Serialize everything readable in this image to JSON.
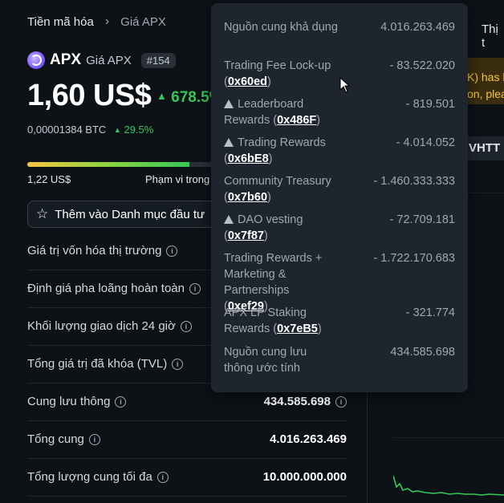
{
  "breadcrumb": {
    "root": "Tiền mã hóa",
    "current": "Giá APX"
  },
  "coin": {
    "symbol": "APX",
    "name": "Giá APX",
    "rank": "#154"
  },
  "price": {
    "value": "1,60 US$",
    "change": "678.5%",
    "btc": "0,00001384 BTC",
    "btc_change": "29.5%"
  },
  "range": {
    "low": "1,22 US$",
    "label": "Phạm vi trong",
    "position_pct": 84
  },
  "watchlist": {
    "label": "Thêm vào Danh mục đầu tư"
  },
  "stats": [
    {
      "label": "Giá trị vốn hóa thị trường",
      "value": ""
    },
    {
      "label": "Định giá pha loãng hoàn toàn",
      "value": ""
    },
    {
      "label": "Khối lượng giao dịch 24 giờ",
      "value": ""
    },
    {
      "label": "Tổng giá trị đã khóa (TVL)",
      "value": ""
    },
    {
      "label": "Cung lưu thông",
      "value": "434.585.698"
    },
    {
      "label": "Tổng cung",
      "value": "4.016.263.469"
    },
    {
      "label": "Tổng lượng cung tối đa",
      "value": "10.000.000.000"
    }
  ],
  "right": {
    "tab": "Thị t",
    "banner_line1": "K) has b",
    "banner_line2": "on, plea",
    "vhtt": "VHTT"
  },
  "tooltip": {
    "total_label": "Nguồn cung khả dụng",
    "total_value": "4.016.263.469",
    "rows": [
      {
        "label": "Trading Fee Lock-up",
        "addr": "0x60ed",
        "value": "- 83.522.020",
        "warn": false
      },
      {
        "label": "Leaderboard Rewards",
        "addr": "0x486F",
        "value": "- 819.501",
        "warn": true
      },
      {
        "label": "Trading Rewards",
        "addr": "0x6bE8",
        "value": "- 4.014.052",
        "warn": true
      },
      {
        "label": "Community Treasury",
        "addr": "0x7b60",
        "value": "- 1.460.333.333",
        "warn": false
      },
      {
        "label": "DAO vesting",
        "addr": "0x7f87",
        "value": "- 72.709.181",
        "warn": true
      },
      {
        "label": "Trading Rewards + Marketing & Partnerships",
        "addr": "0xef29",
        "value": "- 1.722.170.683",
        "warn": false
      },
      {
        "label": "APX LP Staking Rewards",
        "addr": "0x7eB5",
        "value": "- 321.774",
        "warn": false
      }
    ],
    "est_label": "Nguồn cung lưu thông ước tính",
    "est_value": "434.585.698"
  },
  "colors": {
    "background": "#0d1217",
    "positive": "#34c759",
    "tooltip_bg": "#1e252e",
    "warning_banner": "#3a2e0e"
  }
}
